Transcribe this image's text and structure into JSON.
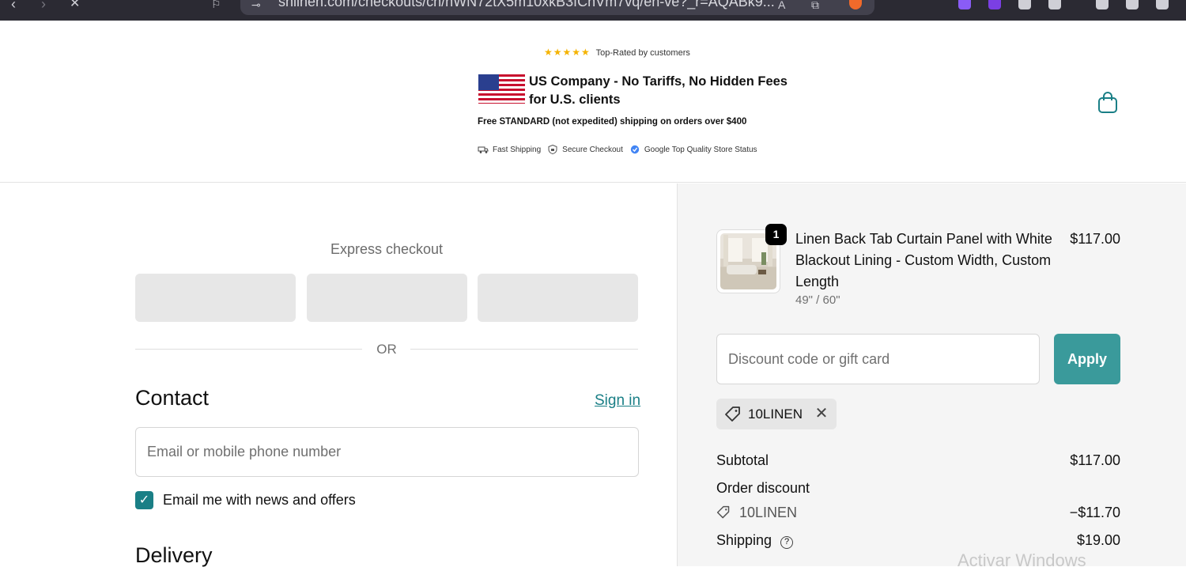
{
  "browser": {
    "url": "shlinen.com/checkouts/cn/hWN72tX5m10xkB3fChVm7vq/en-ve?_r=AQABk9..."
  },
  "header": {
    "stars": "★★★★★",
    "rating_text": "Top-Rated by customers",
    "banner_title": "US Company - No Tariffs, No Hidden Fees for U.S. clients",
    "shipping_note": "Free STANDARD (not expedited) shipping on orders over $400",
    "badges": [
      "Fast Shipping",
      "Secure Checkout",
      "Google Top Quality Store Status"
    ]
  },
  "main": {
    "express_title": "Express checkout",
    "or_text": "OR",
    "contact_heading": "Contact",
    "sign_in": "Sign in",
    "email_placeholder": "Email or mobile phone number",
    "newsletter_label": "Email me with news and offers",
    "newsletter_checked": true,
    "delivery_heading": "Delivery"
  },
  "summary": {
    "quantity": "1",
    "product_name": "Linen Back Tab Curtain Panel with White Blackout Lining - Custom Width, Custom Length",
    "product_variant": "49\" / 60\"",
    "product_price": "$117.00",
    "discount_placeholder": "Discount code or gift card",
    "apply_label": "Apply",
    "applied_code": "10LINEN",
    "subtotal_label": "Subtotal",
    "subtotal_value": "$117.00",
    "order_discount_label": "Order discount",
    "discount_code": "10LINEN",
    "discount_value": "−$11.70",
    "shipping_label": "Shipping",
    "shipping_value": "$19.00"
  },
  "overlay": {
    "watermark": "Activar Windows"
  },
  "colors": {
    "accent": "#1a7f86",
    "apply_button": "#3a9a9b",
    "summary_bg": "#f5f5f5",
    "star": "#f5b300"
  }
}
